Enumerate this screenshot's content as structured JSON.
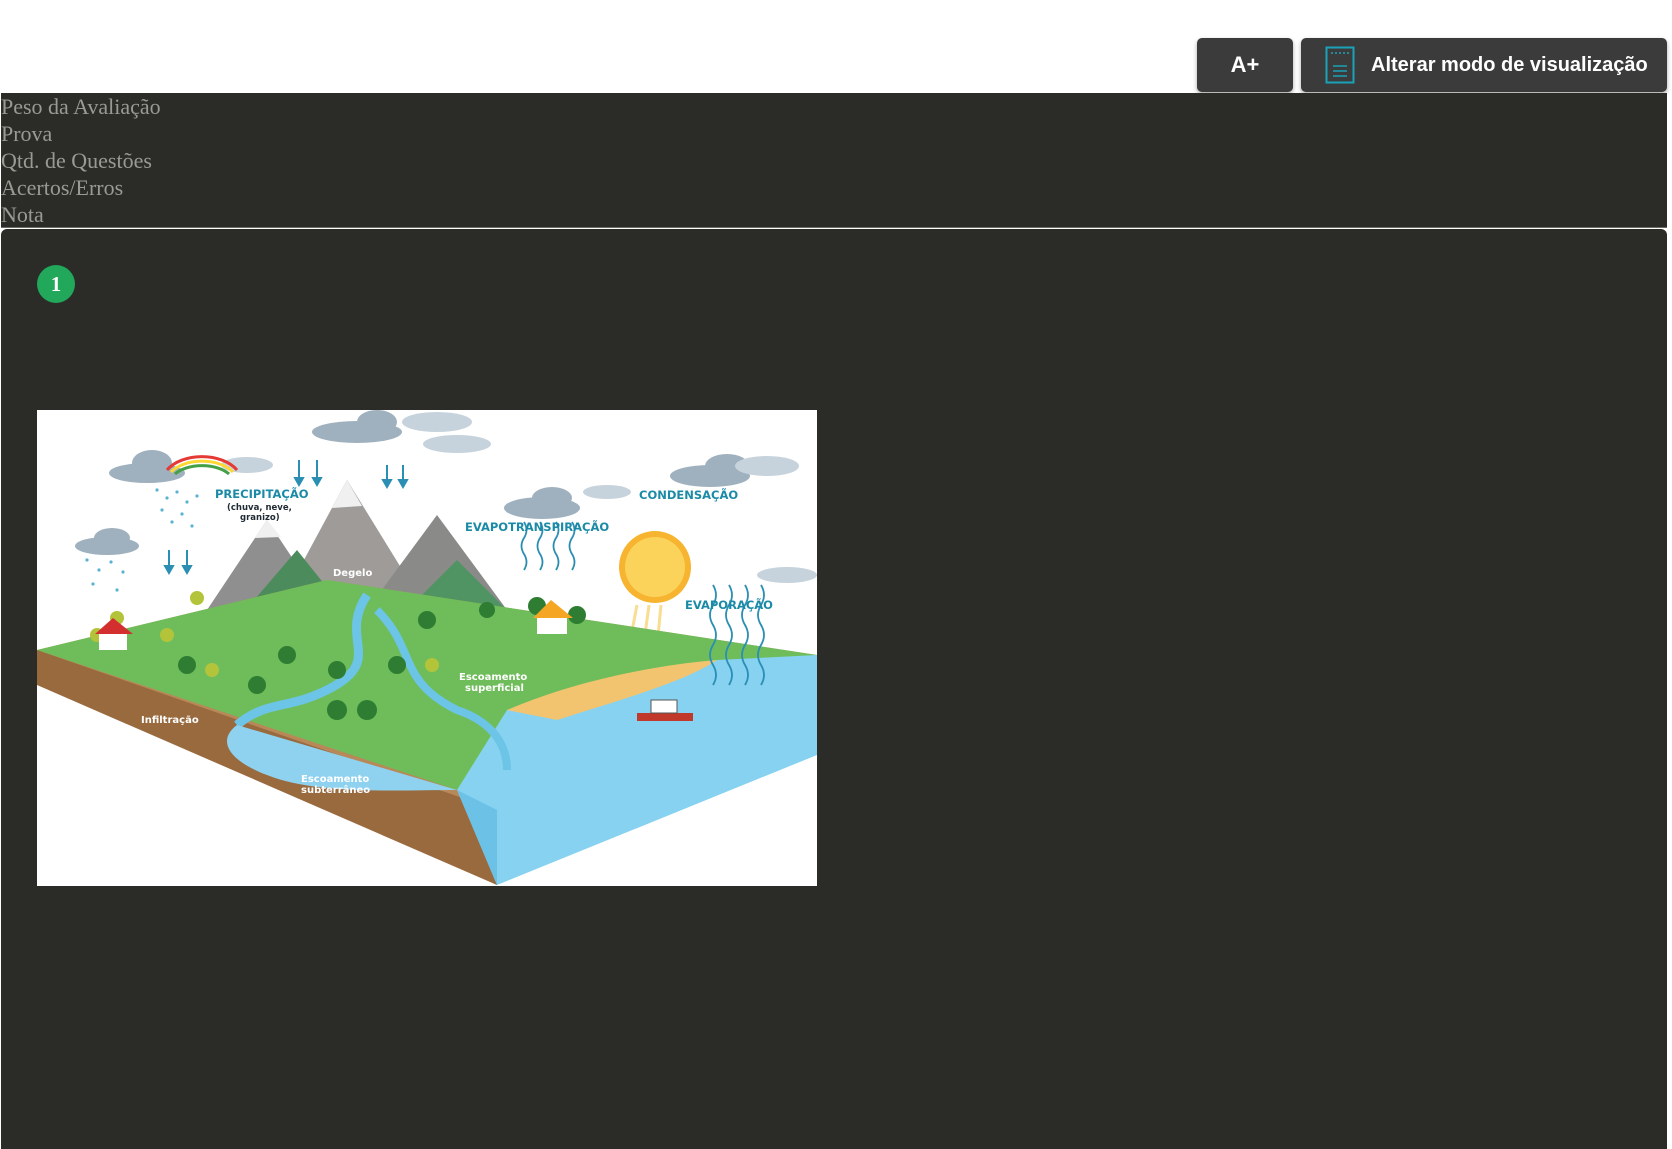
{
  "toolbar": {
    "font_size_label": "A+",
    "view_mode_label": "Alterar modo de visualização"
  },
  "summary": {
    "rows": [
      "Peso da Avaliação",
      "Prova",
      "Qtd. de Questões",
      "Acertos/Erros",
      "Nota"
    ]
  },
  "question": {
    "number": "1",
    "figure": {
      "labels": {
        "precipitacao": "PRECIPITAÇÃO",
        "precipitacao_sub1": "(chuva, neve,",
        "precipitacao_sub2": "granizo)",
        "condensacao": "CONDENSAÇÃO",
        "evapotranspiracao": "EVAPOTRANSPIRAÇÃO",
        "evaporacao": "EVAPORAÇÃO",
        "degelo": "Degelo",
        "escoamento_superficial_1": "Escoamento",
        "escoamento_superficial_2": "superficial",
        "infiltracao": "Infiltração",
        "escoamento_subterraneo_1": "Escoamento",
        "escoamento_subterraneo_2": "subterrâneo"
      }
    }
  },
  "colors": {
    "panel_bg": "#2b2c27",
    "button_bg": "#3b3b3b",
    "badge_green": "#21a85a",
    "label_teal": "#1a8aa6"
  },
  "icons": {
    "view_mode": "document-icon"
  }
}
